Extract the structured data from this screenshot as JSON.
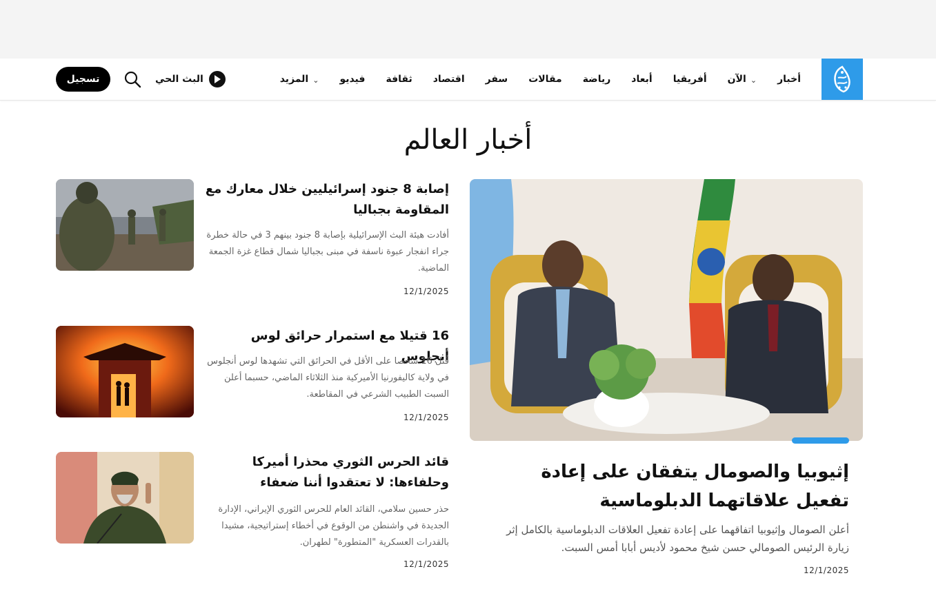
{
  "nav": {
    "items": [
      {
        "label": "أخبار",
        "chevron": false
      },
      {
        "label": "الآن",
        "chevron": true
      },
      {
        "label": "أفريقيا",
        "chevron": false
      },
      {
        "label": "أبعاد",
        "chevron": false
      },
      {
        "label": "رياضة",
        "chevron": false
      },
      {
        "label": "مقالات",
        "chevron": false
      },
      {
        "label": "سفر",
        "chevron": false
      },
      {
        "label": "اقتصاد",
        "chevron": false
      },
      {
        "label": "ثقافة",
        "chevron": false
      },
      {
        "label": "فيديو",
        "chevron": false
      },
      {
        "label": "المزيد",
        "chevron": true
      }
    ],
    "live_label": "البث الحي",
    "register_label": "تسجيل"
  },
  "colors": {
    "brand_blue": "#2e9be9",
    "button_black": "#000000"
  },
  "page": {
    "title": "أخبار العالم"
  },
  "featured": {
    "title": "إثيوبيا والصومال يتفقان على إعادة تفعيل علاقاتهما الدبلوماسية",
    "excerpt": "أعلن الصومال وإثيوبيا اتفاقهما على إعادة تفعيل العلاقات الدبلوماسية بالكامل إثر زيارة الرئيس الصومالي حسن شيخ محمود لأديس أبابا أمس السبت.",
    "date": "12/1/2025"
  },
  "articles": [
    {
      "title": "إصابة 8 جنود إسرائيليين خلال معارك مع المقاومة بجباليا",
      "excerpt": "أفادت هيئة البث الإسرائيلية بإصابة 8 جنود بينهم 3 في حالة خطرة جراء انفجار عبوة ناسفة في مبنى بجباليا شمال قطاع غزة الجمعة الماضية.",
      "date": "12/1/2025"
    },
    {
      "title": "16 قتيلا مع استمرار حرائق لوس أنجلوس",
      "excerpt": "قُتل 16 شخصا على الأقل في الحرائق التي تشهدها لوس أنجلوس في ولاية كاليفورنيا الأميركية منذ الثلاثاء الماضي، حسبما أعلن السبت الطبيب الشرعي في المقاطعة.",
      "date": "12/1/2025"
    },
    {
      "title": "قائد الحرس الثوري محذرا أميركا وحلفاءها: لا تعتقدوا أننا ضعفاء",
      "excerpt": "حذر حسين سلامي، القائد العام للحرس الثوري الإيراني، الإدارة الجديدة في واشنطن من الوقوع في أخطاء إستراتيجية، مشيدا بالقدرات العسكرية \"المتطورة\" لطهران.",
      "date": "12/1/2025"
    }
  ]
}
